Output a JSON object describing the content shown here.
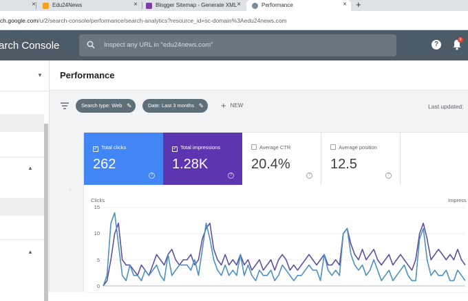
{
  "browser": {
    "tabs": [
      {
        "label": "Edu24News",
        "favicon_color": "#f4a321",
        "active": false
      },
      {
        "label": "Blogger Sitemap - Generate XML",
        "favicon_color": "#7b3fa0",
        "active": false
      },
      {
        "label": "Performance",
        "favicon_color": "#7a8b99",
        "active": true
      }
    ],
    "url_host": "ch.google.com",
    "url_path": "/u/2/search-console/performance/search-analytics?resource_id=sc-domain%3Aedu24news.com"
  },
  "header": {
    "title": "arch Console",
    "search_placeholder": "Inspect any URL in \"edu24news.com\"",
    "help_label": "?",
    "notification_count": "9"
  },
  "page": {
    "title": "Performance",
    "filters": [
      {
        "label": "Search type: Web"
      },
      {
        "label": "Date: Last 3 months"
      }
    ],
    "new_label": "NEW",
    "last_updated": "Last updated:"
  },
  "metrics": [
    {
      "label": "Total clicks",
      "value": "262",
      "checked": true
    },
    {
      "label": "Total impressions",
      "value": "1.28K",
      "checked": true
    },
    {
      "label": "Average CTR",
      "value": "20.4%",
      "checked": false
    },
    {
      "label": "Average position",
      "value": "12.5",
      "checked": false
    }
  ],
  "chart_data": {
    "type": "line",
    "left_axis_title": "Clicks",
    "right_axis_title": "Impress",
    "yticks": [
      "15",
      "10",
      "5",
      "0"
    ],
    "ylim": [
      0,
      15
    ],
    "series": [
      {
        "name": "Clicks",
        "color": "#4a90c2",
        "values": [
          0,
          2,
          12,
          14,
          8,
          2,
          1,
          4,
          2,
          2,
          1,
          3,
          2,
          3,
          4,
          2,
          1,
          6,
          2,
          3,
          4,
          4,
          4,
          3,
          5,
          2,
          7,
          12,
          9,
          5,
          3,
          2,
          4,
          2,
          3,
          2,
          6,
          2,
          4,
          2,
          1,
          3,
          2,
          2,
          3,
          1,
          2,
          4,
          3,
          2,
          1,
          2,
          2,
          3,
          4,
          3,
          3,
          1,
          6,
          3,
          2,
          3,
          2,
          10,
          11,
          6,
          4,
          3,
          4,
          2,
          3,
          5,
          3,
          1,
          2,
          3,
          1,
          2,
          3,
          4,
          2,
          1,
          1,
          9,
          11,
          5,
          2,
          3,
          2,
          2,
          3,
          1,
          1,
          3,
          2,
          1
        ]
      },
      {
        "name": "Impressions",
        "color": "#5e4fa0",
        "values": [
          0,
          1,
          5,
          10,
          12,
          5,
          4,
          4,
          3,
          2,
          4,
          3,
          2,
          4,
          6,
          5,
          4,
          6,
          7,
          5,
          4,
          5,
          5,
          6,
          4,
          5,
          9,
          11,
          12,
          7,
          5,
          4,
          6,
          4,
          5,
          4,
          6,
          4,
          5,
          3,
          4,
          5,
          3,
          4,
          5,
          3,
          5,
          6,
          5,
          3,
          4,
          3,
          4,
          5,
          6,
          5,
          4,
          5,
          6,
          4,
          4,
          5,
          4,
          10,
          11,
          8,
          6,
          5,
          7,
          5,
          6,
          7,
          5,
          4,
          5,
          6,
          4,
          5,
          6,
          5,
          4,
          3,
          5,
          10,
          12,
          9,
          5,
          6,
          7,
          6,
          5,
          6,
          5,
          7,
          5,
          4
        ]
      }
    ]
  }
}
